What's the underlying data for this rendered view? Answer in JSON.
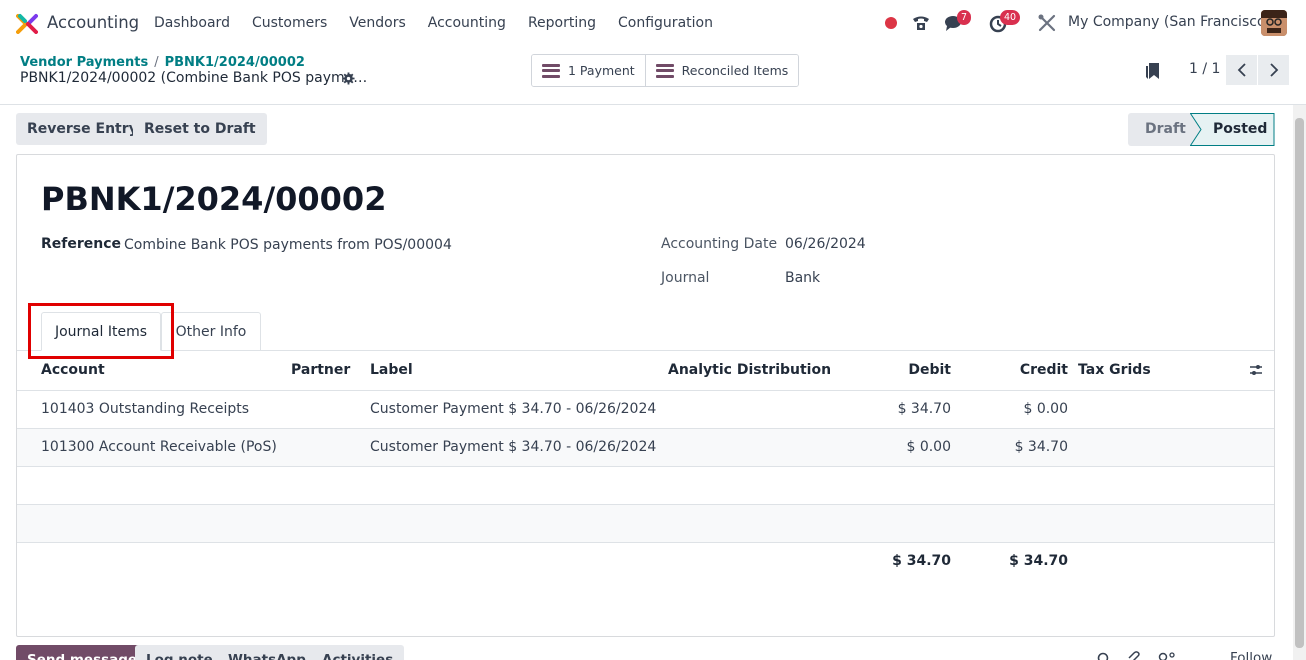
{
  "navbar": {
    "app_name": "Accounting",
    "menu": [
      "Dashboard",
      "Customers",
      "Vendors",
      "Accounting",
      "Reporting",
      "Configuration"
    ],
    "messages_badge": "7",
    "activities_badge": "40",
    "company": "My Company (San Francisco)"
  },
  "control_panel": {
    "breadcrumb": [
      "Vendor Payments",
      "PBNK1/2024/00002"
    ],
    "record_title": "PBNK1/2024/00002 (Combine Bank POS payme…",
    "smart_buttons": [
      "1 Payment",
      "Reconciled Items"
    ],
    "pager": "1 / 1"
  },
  "actions": {
    "reverse_entry": "Reverse Entry",
    "reset_to_draft": "Reset to Draft"
  },
  "status": {
    "draft": "Draft",
    "posted": "Posted",
    "current": "Posted"
  },
  "form": {
    "name": "PBNK1/2024/00002",
    "reference_label": "Reference",
    "reference_value": "Combine Bank POS payments from POS/00004",
    "accounting_date_label": "Accounting Date",
    "accounting_date_value": "06/26/2024",
    "journal_label": "Journal",
    "journal_value": "Bank"
  },
  "tabs": [
    "Journal Items",
    "Other Info"
  ],
  "table": {
    "headers": {
      "account": "Account",
      "partner": "Partner",
      "label": "Label",
      "analytic": "Analytic Distribution",
      "debit": "Debit",
      "credit": "Credit",
      "tax_grids": "Tax Grids"
    },
    "rows": [
      {
        "account": "101403 Outstanding Receipts",
        "partner": "",
        "label": "Customer Payment $ 34.70 - 06/26/2024",
        "debit": "$ 34.70",
        "credit": "$ 0.00"
      },
      {
        "account": "101300 Account Receivable (PoS)",
        "partner": "",
        "label": "Customer Payment $ 34.70 - 06/26/2024",
        "debit": "$ 0.00",
        "credit": "$ 34.70"
      }
    ],
    "total_debit": "$ 34.70",
    "total_credit": "$ 34.70"
  },
  "chatter": {
    "send_message": "Send message",
    "log_note": "Log note",
    "whatsapp": "WhatsApp",
    "activities": "Activities",
    "follow": "Follow"
  }
}
